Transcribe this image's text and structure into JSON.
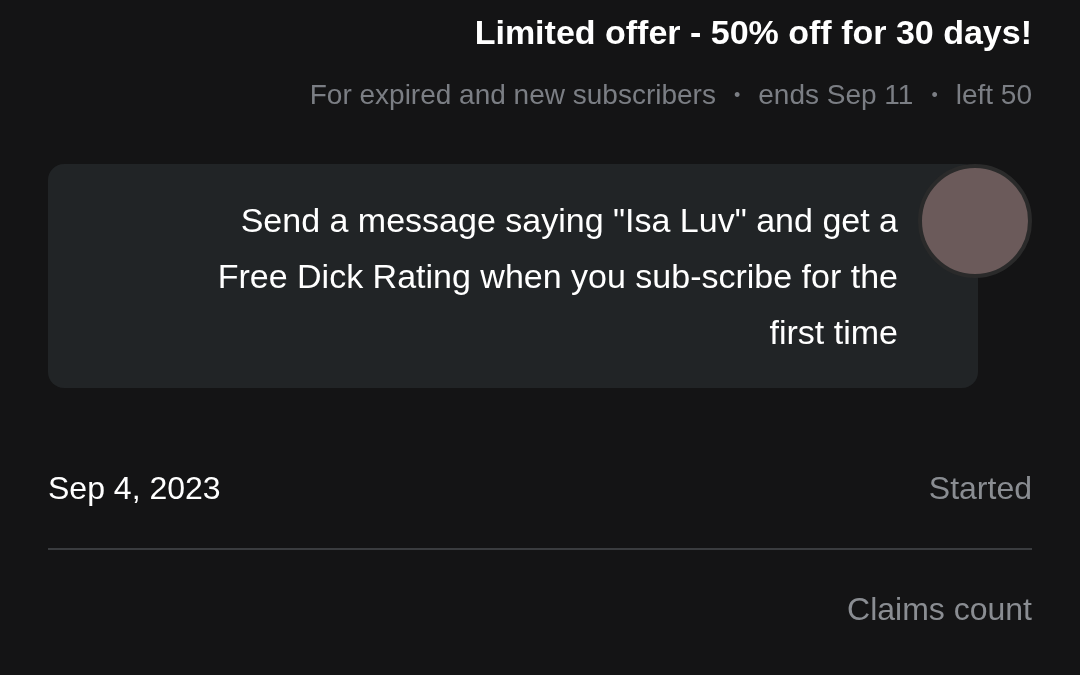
{
  "offer": {
    "title": "Limited offer - 50% off for 30 days!",
    "details": [
      "For expired and new subscribers",
      "ends Sep 11",
      "left 50"
    ],
    "separator": "•"
  },
  "message": {
    "text": "Send a message saying \"Isa Luv\" and get a Free Dick Rating when you sub-scribe for the first time"
  },
  "rows": [
    {
      "label": "Started",
      "value": "Sep 4, 2023"
    },
    {
      "label": "Claims count"
    }
  ]
}
